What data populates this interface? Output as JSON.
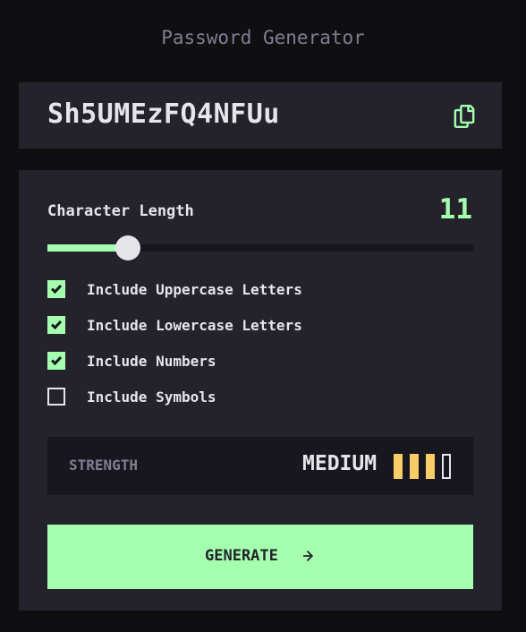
{
  "app": {
    "title": "Password Generator"
  },
  "password": {
    "value": "Sh5UMEzFQ4NFUu",
    "copy_icon": "copy-icon"
  },
  "length": {
    "label": "Character Length",
    "value": "11",
    "min": 0,
    "max": 20,
    "fraction": 0.19
  },
  "options": [
    {
      "label": "Include Uppercase Letters",
      "checked": true
    },
    {
      "label": "Include Lowercase Letters",
      "checked": true
    },
    {
      "label": "Include Numbers",
      "checked": true
    },
    {
      "label": "Include Symbols",
      "checked": false
    }
  ],
  "strength": {
    "label": "STRENGTH",
    "value": "MEDIUM",
    "level": 3,
    "max_level": 4
  },
  "generate": {
    "label": "GENERATE",
    "icon": "arrow-right-icon"
  },
  "colors": {
    "accent": "#a4ffaf",
    "panel": "#24232c",
    "strength_bar": "#f8cd65",
    "muted": "#817d92"
  }
}
